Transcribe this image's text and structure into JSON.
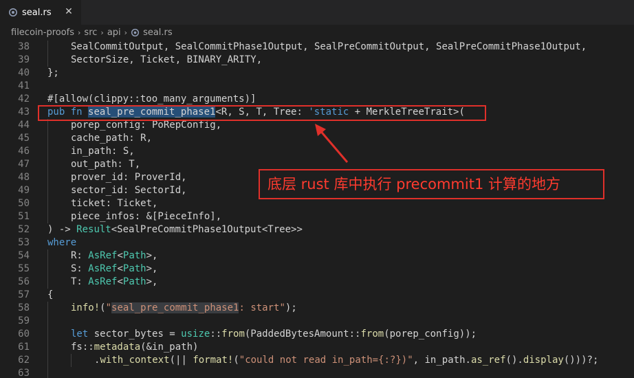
{
  "tab": {
    "label": "seal.rs",
    "close": "✕",
    "file_icon": "rust-file-icon"
  },
  "breadcrumb": {
    "items": [
      "filecoin-proofs",
      "src",
      "api",
      "seal.rs"
    ],
    "separator": "›"
  },
  "code_lines": [
    {
      "n": "38",
      "indent": 2,
      "html": "SealCommitOutput, SealCommitPhase1Output, SealPreCommitOutput, SealPreCommitPhase1Output,"
    },
    {
      "n": "39",
      "indent": 2,
      "html": "SectorSize, Ticket, BINARY_ARITY,"
    },
    {
      "n": "40",
      "indent": 1,
      "html": "};"
    },
    {
      "n": "41",
      "indent": 0,
      "html": ""
    },
    {
      "n": "42",
      "indent": 1,
      "html": "#[allow(clippy::too_many_arguments)]"
    },
    {
      "n": "43",
      "indent": 1,
      "html": "<span class=\"kw\">pub</span> <span class=\"kw\">fn</span> <span class=\"hl\">seal_pre_commit_phase1</span>&lt;R, S, T, Tree: <span class=\"kw\">'static</span> + MerkleTreeTrait&gt;("
    },
    {
      "n": "44",
      "indent": 2,
      "html": "porep_config: PoRepConfig,"
    },
    {
      "n": "45",
      "indent": 2,
      "html": "cache_path: R,"
    },
    {
      "n": "46",
      "indent": 2,
      "html": "in_path: S,"
    },
    {
      "n": "47",
      "indent": 2,
      "html": "out_path: T,"
    },
    {
      "n": "48",
      "indent": 2,
      "html": "prover_id: ProverId,"
    },
    {
      "n": "49",
      "indent": 2,
      "html": "sector_id: SectorId,"
    },
    {
      "n": "50",
      "indent": 2,
      "html": "ticket: Ticket,"
    },
    {
      "n": "51",
      "indent": 2,
      "html": "piece_infos: &amp;[PieceInfo],"
    },
    {
      "n": "52",
      "indent": 1,
      "html": ") -&gt; <span class=\"ty\">Result</span>&lt;SealPreCommitPhase1Output&lt;Tree&gt;&gt;"
    },
    {
      "n": "53",
      "indent": 1,
      "html": "<span class=\"kw\">where</span>"
    },
    {
      "n": "54",
      "indent": 2,
      "html": "R: <span class=\"ty\">AsRef</span>&lt;<span class=\"ty\">Path</span>&gt;,"
    },
    {
      "n": "55",
      "indent": 2,
      "html": "S: <span class=\"ty\">AsRef</span>&lt;<span class=\"ty\">Path</span>&gt;,"
    },
    {
      "n": "56",
      "indent": 2,
      "html": "T: <span class=\"ty\">AsRef</span>&lt;<span class=\"ty\">Path</span>&gt;,"
    },
    {
      "n": "57",
      "indent": 1,
      "html": "{"
    },
    {
      "n": "58",
      "indent": 2,
      "html": "<span class=\"fn\">info!</span>(<span class=\"str\">\"<span class=\"shl\">seal_pre_commit_phase1</span>: start\"</span>);"
    },
    {
      "n": "59",
      "indent": 2,
      "html": ""
    },
    {
      "n": "60",
      "indent": 2,
      "html": "<span class=\"kw\">let</span> sector_bytes = <span class=\"ty\">usize</span>::<span class=\"fn\">from</span>(PaddedBytesAmount::<span class=\"fn\">from</span>(porep_config));"
    },
    {
      "n": "61",
      "indent": 2,
      "html": "fs::<span class=\"fn\">metadata</span>(&amp;in_path)"
    },
    {
      "n": "62",
      "indent": 3,
      "html": ".<span class=\"fn\">with_context</span>(|| <span class=\"fn\">format!</span>(<span class=\"str\">\"could not read in_path={:?})\"</span>, in_path.<span class=\"fn\">as_ref</span>().<span class=\"fn\">display</span>()))?;"
    },
    {
      "n": "63",
      "indent": 2,
      "html": ""
    }
  ],
  "annotation": {
    "text": "底层 rust 库中执行 precommit1 计算的地方",
    "color": "#e0302a"
  },
  "colors": {
    "keyword": "#569cd6",
    "type": "#4ec9b0",
    "function": "#dcdcaa",
    "string": "#ce9178",
    "selection": "#264f78"
  }
}
